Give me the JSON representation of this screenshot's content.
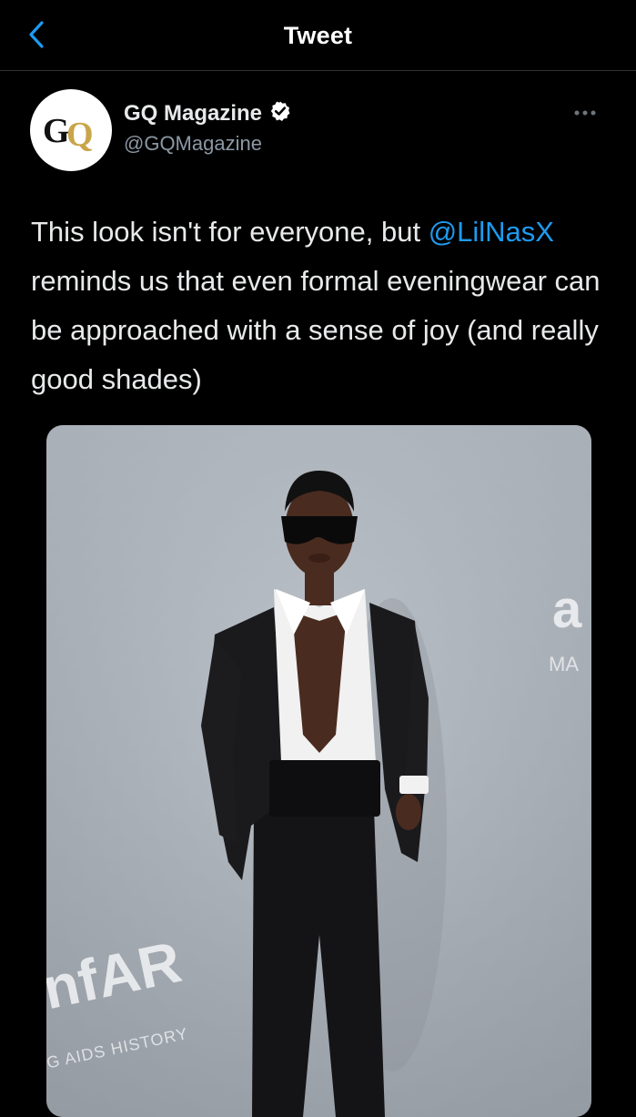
{
  "topbar": {
    "title": "Tweet",
    "back_icon": "chevron-left-icon",
    "accent": "#1d9bf0"
  },
  "author": {
    "display_name": "GQ Magazine",
    "handle": "@GQMagazine",
    "verified": true,
    "avatar_logo": "GQ"
  },
  "tweet": {
    "text_before": "This look isn't for everyone, but ",
    "mention": "@LilNasX",
    "text_after": " reminds us that even formal eveningwear can be approached with a sense of joy (and really good shades)"
  },
  "media": {
    "backdrop_text_1": "nfAR",
    "backdrop_text_2": "G AIDS HISTORY",
    "backdrop_text_3": "a",
    "backdrop_text_4": "MA"
  },
  "colors": {
    "background": "#000000",
    "divider": "#2f3336",
    "text_primary": "#e7e9ea",
    "text_secondary": "#8b98a5",
    "gq_gold": "#c9a54a"
  }
}
